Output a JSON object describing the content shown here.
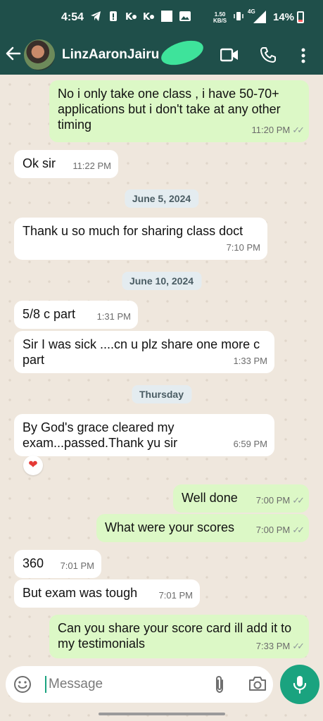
{
  "status_bar": {
    "time": "4:54",
    "speed": "1.50",
    "speed_unit": "KB/S",
    "network": "4G",
    "battery": "14%"
  },
  "header": {
    "contact_name": "LinzAaronJairu",
    "icons": [
      "back-arrow-icon",
      "video-call-icon",
      "voice-call-icon",
      "more-options-icon"
    ]
  },
  "messages": [
    {
      "dir": "out",
      "text": "No i only take one class , i have 50-70+ applications but i don't take at any other timing",
      "time": "11:20 PM"
    },
    {
      "dir": "in",
      "text": "Ok sir",
      "time": "11:22 PM"
    },
    {
      "type": "date",
      "text": "June 5, 2024"
    },
    {
      "dir": "in",
      "text": "Thank u so much for sharing class doct",
      "time": "7:10 PM"
    },
    {
      "type": "date",
      "text": "June 10, 2024"
    },
    {
      "dir": "in",
      "text": "5/8 c part",
      "time": "1:31 PM"
    },
    {
      "dir": "in",
      "text": "Sir I was sick ....cn u plz share one more c part",
      "time": "1:33 PM"
    },
    {
      "type": "date",
      "text": "Thursday"
    },
    {
      "dir": "in",
      "text": "By God's grace cleared my exam...passed.Thank yu sir",
      "time": "6:59 PM",
      "reaction": "❤"
    },
    {
      "dir": "out",
      "text": "Well done",
      "time": "7:00 PM"
    },
    {
      "dir": "out",
      "text": "What were your scores",
      "time": "7:00 PM"
    },
    {
      "dir": "in",
      "text": "360",
      "time": "7:01 PM"
    },
    {
      "dir": "in",
      "text": "But exam was tough",
      "time": "7:01 PM"
    },
    {
      "dir": "out",
      "text": "Can you share your score card ill add it to my testimonials",
      "time": "7:33 PM"
    }
  ],
  "input": {
    "placeholder": "Message"
  },
  "colors": {
    "header": "#1f4f4a",
    "chat_background": "#efe7dd",
    "outgoing_bubble": "#dcf8c6",
    "incoming_bubble": "#ffffff",
    "accent": "#1aa37f"
  }
}
